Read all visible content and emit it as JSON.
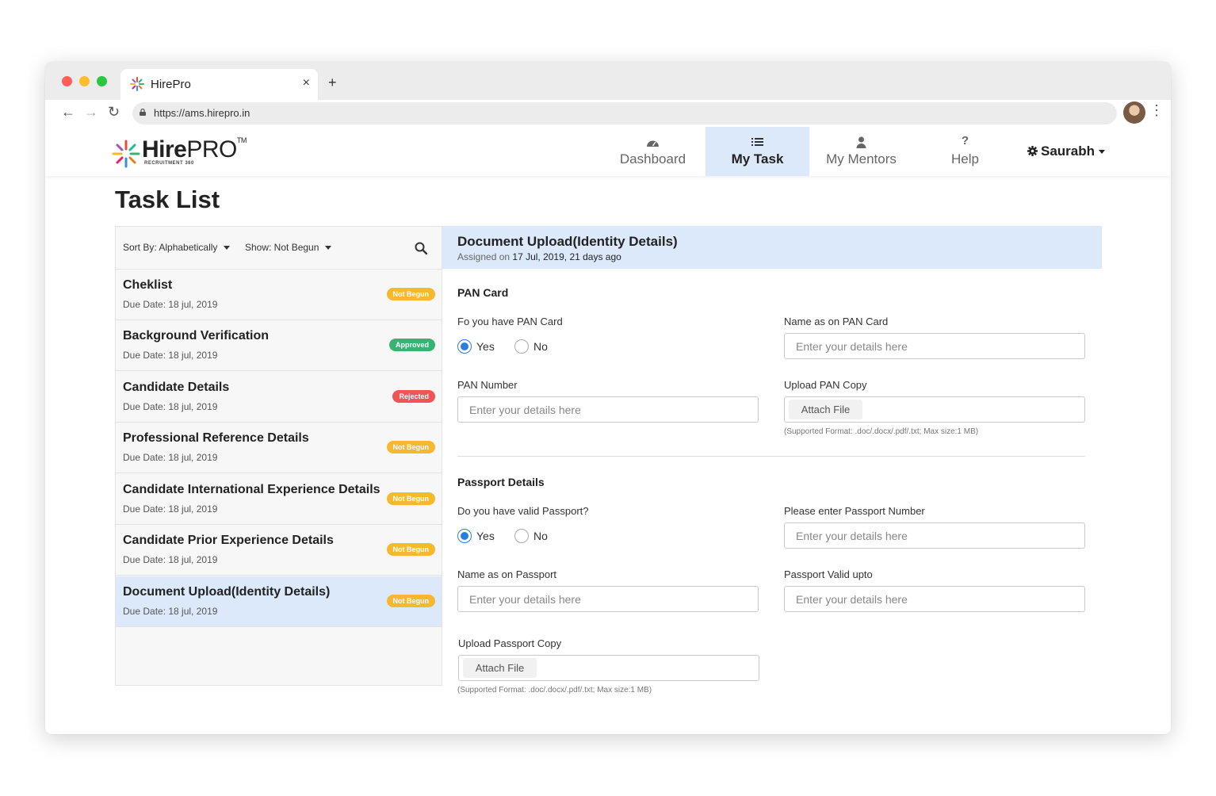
{
  "browser": {
    "tab_title": "HirePro",
    "close_glyph": "×",
    "new_tab_glyph": "+",
    "url": "https://ams.hirepro.in",
    "back_glyph": "←",
    "forward_glyph": "→",
    "reload_glyph": "↻",
    "menu_glyph": "⋮"
  },
  "brand": {
    "name_bold": "Hire",
    "name_light": "PRO",
    "tm": "TM",
    "tagline": "RECRUITMENT 360"
  },
  "nav": {
    "items": [
      {
        "label": "Dashboard",
        "icon": "gauge-icon"
      },
      {
        "label": "My Task",
        "icon": "list-icon",
        "active": true
      },
      {
        "label": "My Mentors",
        "icon": "person-icon"
      },
      {
        "label": "Help",
        "icon": "question-icon"
      }
    ],
    "help_glyph": "?",
    "user": "Saurabh"
  },
  "page": {
    "title": "Task List"
  },
  "filters": {
    "sort": "Sort By: Alphabetically",
    "show": "Show: Not Begun"
  },
  "tasks": [
    {
      "name": "Cheklist",
      "due": "Due Date: 18 jul, 2019",
      "status": "Not Begun"
    },
    {
      "name": "Background Verification",
      "due": "Due Date: 18 jul, 2019",
      "status": "Approved"
    },
    {
      "name": "Candidate Details",
      "due": "Due Date: 18 jul, 2019",
      "status": "Rejected"
    },
    {
      "name": "Professional Reference Details",
      "due": "Due Date: 18 jul, 2019",
      "status": "Not Begun"
    },
    {
      "name": "Candidate International Experience Details",
      "due": "Due Date: 18 jul, 2019",
      "status": "Not Begun"
    },
    {
      "name": "Candidate Prior Experience Details",
      "due": "Due Date: 18 jul, 2019",
      "status": "Not Begun"
    },
    {
      "name": "Document Upload(Identity Details)",
      "due": "Due Date: 18 jul, 2019",
      "status": "Not Begun",
      "active": true
    }
  ],
  "status_colors": {
    "Not Begun": "#f5b82e",
    "Approved": "#3bb273",
    "Rejected": "#f05454"
  },
  "detail": {
    "title": "Document Upload(Identity Details)",
    "assigned_prefix": "Assigned on",
    "assigned_date": "17 Jul, 2019, 21 days ago",
    "pan": {
      "section": "PAN Card",
      "have_label": "Fo you have PAN Card",
      "yes": "Yes",
      "no": "No",
      "selected": "Yes",
      "name_label": "Name as on PAN Card",
      "name_placeholder": "Enter your details here",
      "number_label": "PAN Number",
      "number_placeholder": "Enter your details here",
      "upload_label": "Upload PAN Copy",
      "attach": "Attach File",
      "hint": "(Supported Format: .doc/.docx/.pdf/.txt; Max size:1 MB)"
    },
    "passport": {
      "section": "Passport Details",
      "have_label": "Do you have valid Passport?",
      "yes": "Yes",
      "no": "No",
      "selected": "Yes",
      "number_label": "Please enter Passport Number",
      "number_placeholder": "Enter your details here",
      "name_label": "Name as on Passport",
      "name_placeholder": "Enter your details here",
      "valid_label": "Passport Valid upto",
      "valid_placeholder": "Enter your details here",
      "upload_label": "Upload Passport Copy",
      "attach": "Attach File",
      "hint": "(Supported Format: .doc/.docx/.pdf/.txt; Max size:1 MB)"
    }
  },
  "colors": {
    "accent_light": "#dbe9fb",
    "radio_blue": "#2a7de1"
  }
}
